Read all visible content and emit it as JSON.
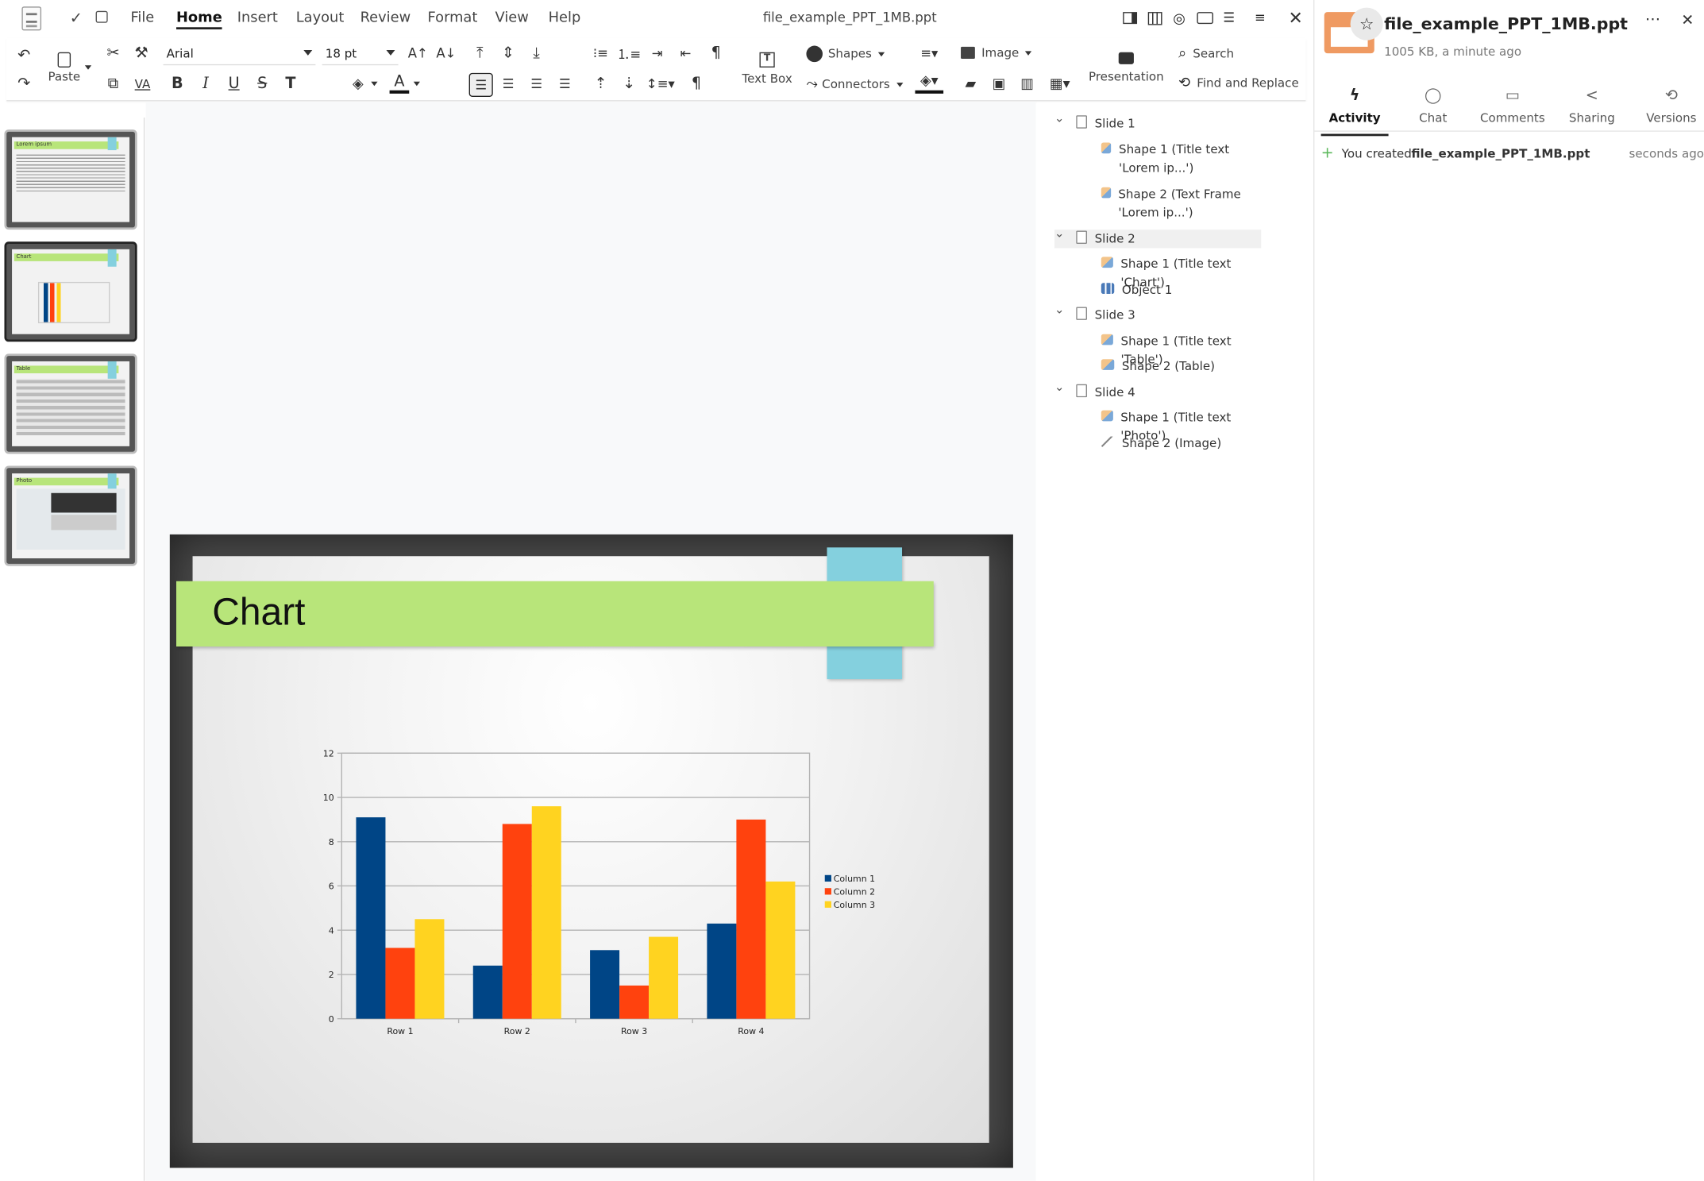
{
  "window": {
    "title": "file_example_PPT_1MB.ppt"
  },
  "menu": {
    "file": "File",
    "home": "Home",
    "insert": "Insert",
    "layout": "Layout",
    "review": "Review",
    "format": "Format",
    "view": "View",
    "help": "Help"
  },
  "toolbar": {
    "paste_label": "Paste",
    "font_name": "Arial",
    "font_size": "18 pt",
    "textbox_label": "Text Box",
    "shapes_label": "Shapes",
    "connectors_label": "Connectors",
    "image_label": "Image",
    "presentation_label": "Presentation",
    "search_label": "Search",
    "find_replace_label": "Find and Replace"
  },
  "thumbnails": [
    {
      "title": "Lorem ipsum"
    },
    {
      "title": "Chart"
    },
    {
      "title": "Table"
    },
    {
      "title": "Photo"
    }
  ],
  "slide": {
    "title": "Chart"
  },
  "chart_data": {
    "type": "bar",
    "categories": [
      "Row 1",
      "Row 2",
      "Row 3",
      "Row 4"
    ],
    "series": [
      {
        "name": "Column 1",
        "values": [
          9.1,
          2.4,
          3.1,
          4.3
        ]
      },
      {
        "name": "Column 2",
        "values": [
          3.2,
          8.8,
          1.5,
          9.0
        ]
      },
      {
        "name": "Column 3",
        "values": [
          4.5,
          9.6,
          3.7,
          6.2
        ]
      }
    ],
    "colors": [
      "#004586",
      "#ff420e",
      "#ffd320"
    ],
    "ylim": [
      0,
      12
    ],
    "yticks": [
      "0",
      "2",
      "4",
      "6",
      "8",
      "10",
      "12"
    ],
    "legend": "right",
    "grid": true,
    "title": "",
    "xlabel": "",
    "ylabel": ""
  },
  "navigator": {
    "items": [
      {
        "label": "Slide 1",
        "kind": "slide"
      },
      {
        "label": "Shape 1 (Title text 'Lorem ip...')",
        "kind": "shape"
      },
      {
        "label": "Shape 2 (Text Frame 'Lorem ip...')",
        "kind": "shape"
      },
      {
        "label": "Slide 2",
        "kind": "slide"
      },
      {
        "label": "Shape 1 (Title text 'Chart')",
        "kind": "shape"
      },
      {
        "label": "Object 1",
        "kind": "object"
      },
      {
        "label": "Slide 3",
        "kind": "slide"
      },
      {
        "label": "Shape 1 (Title text 'Table')",
        "kind": "shape"
      },
      {
        "label": "Shape 2 (Table)",
        "kind": "shape"
      },
      {
        "label": "Slide 4",
        "kind": "slide"
      },
      {
        "label": "Shape 1 (Title text 'Photo')",
        "kind": "shape"
      },
      {
        "label": "Shape 2 (Image)",
        "kind": "image"
      }
    ]
  },
  "sidebar": {
    "filename": "file_example_PPT_1MB.ppt",
    "meta": "1005 KB, a minute ago",
    "tabs": [
      "Activity",
      "Chat",
      "Comments",
      "Sharing",
      "Versions"
    ],
    "activity": {
      "prefix": "You created",
      "file": "file_example_PPT_1MB.ppt",
      "time": "seconds ago"
    }
  },
  "colors": {
    "title_band": "#b8e57a",
    "tag": "#84d0de",
    "accent_created": "#5cb85c"
  }
}
